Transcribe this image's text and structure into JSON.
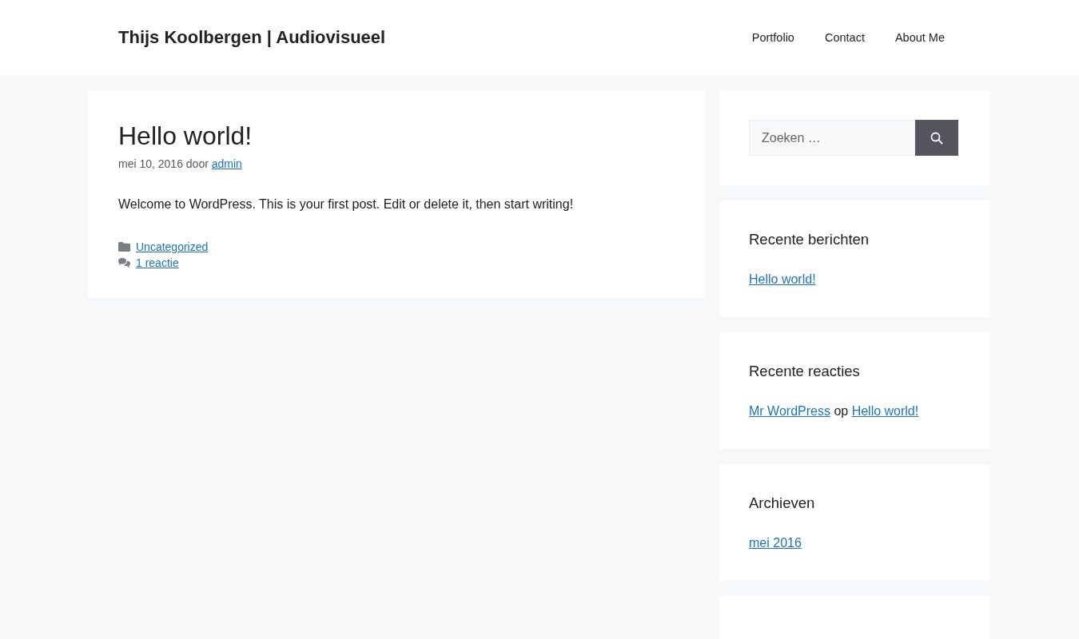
{
  "header": {
    "site_title": "Thijs Koolbergen | Audiovisueel",
    "nav": [
      {
        "label": "Portfolio"
      },
      {
        "label": "Contact"
      },
      {
        "label": "About Me"
      }
    ]
  },
  "post": {
    "title": "Hello world!",
    "meta_date": "mei 10, 2016 door",
    "author": "admin",
    "body": "Welcome to WordPress. This is your first post. Edit or delete it, then start writing!",
    "footer": [
      {
        "kind": "category",
        "link": "Uncategorized"
      },
      {
        "kind": "comments",
        "link": "1 reactie"
      }
    ]
  },
  "sidebar": {
    "search": {
      "placeholder": "Zoeken …"
    },
    "widgets": [
      {
        "title": "Recente berichten",
        "kind": "links",
        "links": [
          "Hello world!"
        ]
      },
      {
        "title": "Recente reacties",
        "kind": "comment",
        "author": "Mr WordPress",
        "joiner": "op",
        "post": "Hello world!"
      },
      {
        "title": "Archieven",
        "kind": "links",
        "links": [
          "mei 2016"
        ]
      }
    ]
  }
}
